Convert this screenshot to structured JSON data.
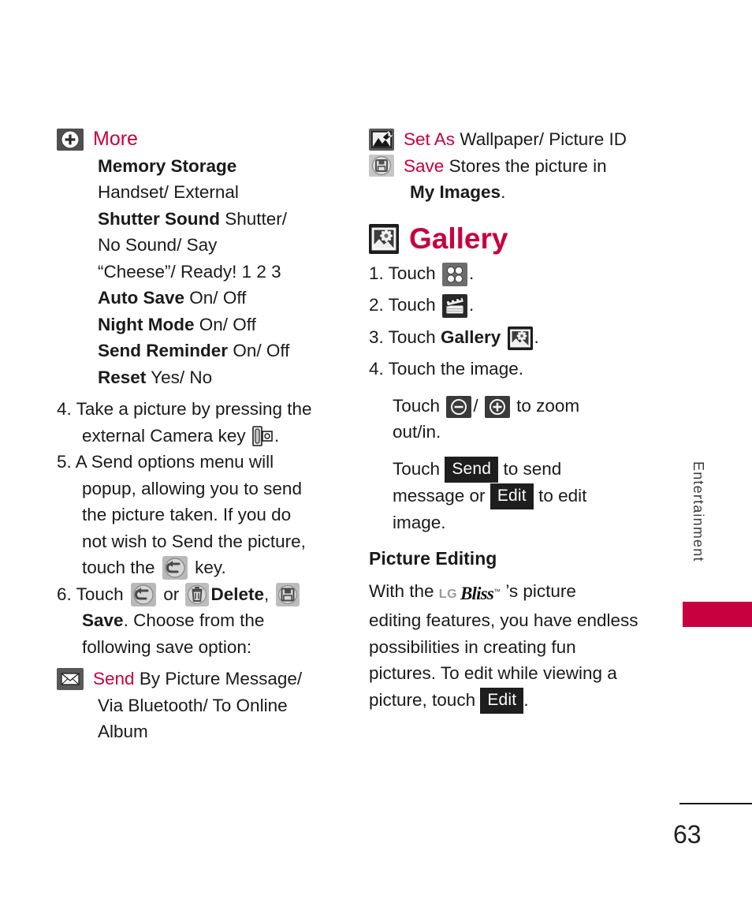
{
  "page": {
    "number": "63",
    "side_tab_label": "Entertainment",
    "accent_color": "#c8003f"
  },
  "left_column": {
    "more_section": {
      "icon": "plus-circle-icon",
      "heading": "More",
      "settings": [
        {
          "name": "Memory Storage",
          "values": "Handset/ External"
        },
        {
          "name": "Shutter Sound",
          "values": "Shutter/ No Sound/ Say “Cheese”/ Ready! 1 2 3"
        },
        {
          "name": "Auto Save",
          "values": "On/ Off"
        },
        {
          "name": "Night Mode",
          "values": "On/ Off"
        },
        {
          "name": "Send Reminder",
          "values": "On/ Off"
        },
        {
          "name": "Reset",
          "values": "Yes/ No"
        }
      ],
      "lines": {
        "memory_storage": "Memory Storage",
        "handset_external": "Handset/ External",
        "shutter_sound": "Shutter Sound",
        "shutter_values_1": "Shutter/",
        "shutter_values_2": "No Sound/ Say",
        "shutter_values_3": "“Cheese”/ Ready! 1 2 3",
        "auto_save": "Auto Save",
        "auto_save_values": "On/ Off",
        "night_mode": "Night Mode",
        "night_mode_values": "On/ Off",
        "send_reminder": "Send Reminder",
        "send_reminder_values": "On/ Off",
        "reset": "Reset",
        "reset_values": "Yes/ No"
      }
    },
    "step4": {
      "number": "4.",
      "text_line1": "Take a picture by pressing the",
      "text_line2": "external Camera key",
      "icon": "camera-key-icon",
      "period": "."
    },
    "step5": {
      "number": "5.",
      "line1": "A Send options menu will",
      "line2": "popup, allowing you to send",
      "line3": "the picture taken. If you do",
      "line4": "not wish to Send the picture,",
      "line5_pre": "touch the",
      "icon": "back-arrow-icon",
      "line5_post": "key."
    },
    "step6": {
      "number": "6.",
      "touch": "Touch",
      "back_icon": "back-arrow-icon",
      "or": "or",
      "delete_icon": "trash-icon",
      "delete_label": "Delete",
      "comma": ",",
      "save_icon": "floppy-disk-icon",
      "save_label": "Save",
      "rest": ". Choose from the",
      "line3": "following save option:"
    },
    "send_option": {
      "icon": "envelope-icon",
      "heading": "Send",
      "line1": "By Picture Message/",
      "line2": "Via Bluetooth/ To Online",
      "line3": "Album"
    }
  },
  "right_column": {
    "set_as": {
      "icon": "set-as-picture-icon",
      "heading": "Set As",
      "values": "Wallpaper/ Picture ID"
    },
    "save": {
      "icon": "floppy-disk-circle-icon",
      "heading": "Save",
      "desc_line1": "Stores the picture in",
      "desc_bold": "My Images",
      "desc_end": "."
    },
    "gallery": {
      "icon": "gallery-photo-icon",
      "title": "Gallery",
      "steps": [
        {
          "number": "1.",
          "text": "Touch",
          "icon": "menu-grid-icon",
          "period": "."
        },
        {
          "number": "2.",
          "text": "Touch",
          "icon": "clapperboard-icon",
          "period": "."
        },
        {
          "number": "3.",
          "text": "Touch",
          "bold": "Gallery",
          "icon": "gallery-photo-icon",
          "period": "."
        },
        {
          "number": "4.",
          "text": "Touch the image.",
          "icon": "",
          "period": ""
        }
      ],
      "zoom_line": {
        "touch": "Touch",
        "zoom_out_icon": "zoom-out-icon",
        "slash": "/",
        "zoom_in_icon": "zoom-in-icon",
        "suffix": "to zoom",
        "line2": "out/in."
      },
      "send_line": {
        "touch": "Touch",
        "send_button": "Send",
        "to_send": "to send",
        "message_or": "message or",
        "edit_button": "Edit",
        "to_edit": "to edit",
        "line3": "image."
      }
    },
    "picture_editing": {
      "heading": "Picture Editing",
      "body_pre": "With the",
      "brand_lg": "LG",
      "brand_name": "Bliss",
      "brand_tm": "™",
      "body_1": "’s picture",
      "body_2": "editing features, you have endless",
      "body_3": "possibilities in creating fun",
      "body_4": "pictures. To edit while viewing a",
      "body_5_pre": "picture, touch",
      "edit_button": "Edit",
      "body_5_post": "."
    }
  }
}
